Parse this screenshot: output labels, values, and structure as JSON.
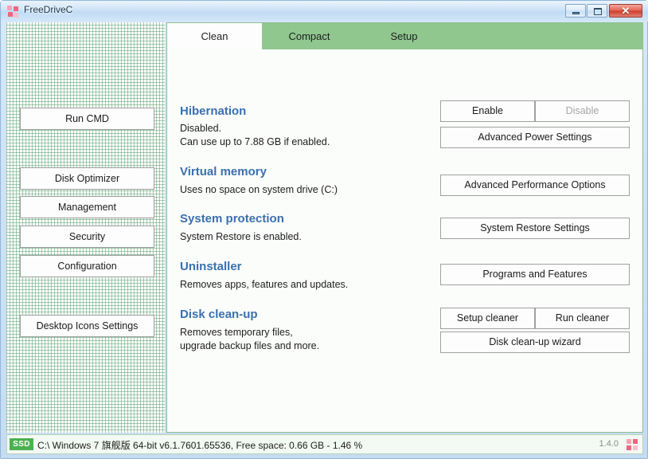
{
  "window": {
    "title": "FreeDriveC",
    "app_icon": "app-pixels-icon",
    "controls": {
      "minimize": "minimize-icon",
      "maximize": "maximize-icon",
      "close": "✕"
    }
  },
  "sidebar": {
    "buttons": [
      {
        "id": "run-cmd",
        "label": "Run CMD"
      },
      {
        "id": "disk-optimizer",
        "label": "Disk Optimizer"
      },
      {
        "id": "management",
        "label": "Management"
      },
      {
        "id": "security",
        "label": "Security"
      },
      {
        "id": "configuration",
        "label": "Configuration"
      },
      {
        "id": "desktop-icons",
        "label": "Desktop Icons Settings"
      }
    ]
  },
  "tabs": [
    {
      "id": "clean",
      "label": "Clean",
      "active": true
    },
    {
      "id": "compact",
      "label": "Compact",
      "active": false
    },
    {
      "id": "setup",
      "label": "Setup",
      "active": false
    }
  ],
  "sections": [
    {
      "id": "hibernation",
      "heading": "Hibernation",
      "line1": "Disabled.",
      "line2": "Can use up to 7.88 GB if enabled."
    },
    {
      "id": "virtual-memory",
      "heading": "Virtual memory",
      "line1": "Uses no space on system drive (C:)"
    },
    {
      "id": "system-protection",
      "heading": "System protection",
      "line1": "System Restore is enabled."
    },
    {
      "id": "uninstaller",
      "heading": "Uninstaller",
      "line1": "Removes apps, features and updates."
    },
    {
      "id": "disk-cleanup",
      "heading": "Disk clean-up",
      "line1": "Removes temporary files,",
      "line2": "upgrade backup files and more."
    }
  ],
  "actions": {
    "enable": "Enable",
    "disable": "Disable",
    "advanced_power_settings": "Advanced Power Settings",
    "advanced_performance_options": "Advanced Performance Options",
    "system_restore_settings": "System Restore Settings",
    "programs_and_features": "Programs and Features",
    "setup_cleaner": "Setup cleaner",
    "run_cleaner": "Run cleaner",
    "disk_cleanup_wizard": "Disk clean-up wizard"
  },
  "statusbar": {
    "badge": "SSD",
    "text": "C:\\ Windows 7 旗舰版  64-bit v6.1.7601.65536, Free space: 0.66 GB - 1.46 %",
    "version": "1.4.0",
    "icon": "app-pixels-icon"
  },
  "colors": {
    "tabbar_green": "#8fc78f",
    "heading_blue": "#3a6fae",
    "badge_green": "#4cb050",
    "close_red": "#cf3f2d"
  }
}
